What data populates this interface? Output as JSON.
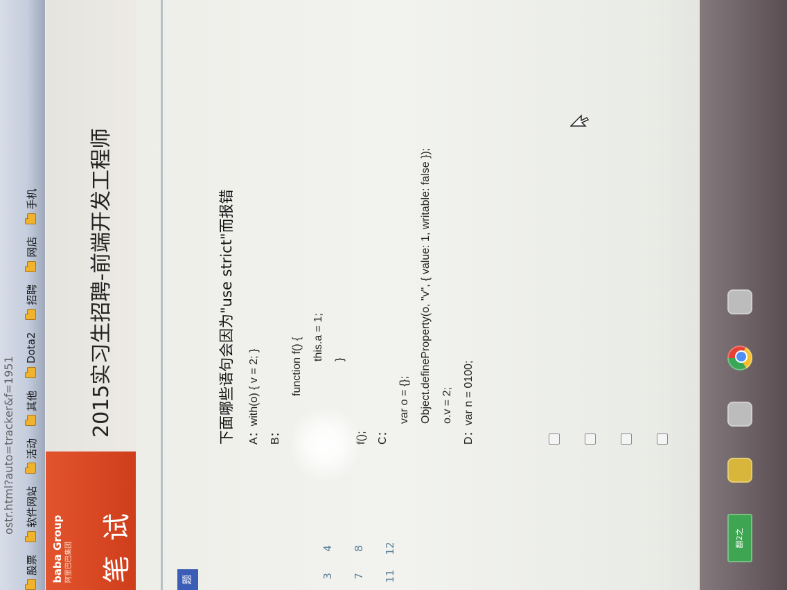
{
  "browser": {
    "url_fragment": "ostr.html?auto=tracker&f=1951",
    "bookmarks": [
      {
        "label": "股票",
        "icon": "folder-icon"
      },
      {
        "label": "软件网站",
        "icon": "folder-icon"
      },
      {
        "label": "活动",
        "icon": "folder-icon"
      },
      {
        "label": "其他",
        "icon": "folder-icon"
      },
      {
        "label": "Dota2",
        "icon": "folder-icon"
      },
      {
        "label": "招聘",
        "icon": "folder-icon"
      },
      {
        "label": "网店",
        "icon": "folder-icon"
      },
      {
        "label": "手机",
        "icon": "folder-icon"
      }
    ]
  },
  "header": {
    "brand": "baba Group",
    "brand_sub": "阿里巴巴集团",
    "section_title": "笔 试",
    "job_title": "2015实习生招聘-前端开发工程师"
  },
  "sidebar": {
    "tab_label": "题",
    "question_numbers": [
      [
        "3",
        "4"
      ],
      [
        "7",
        "8"
      ],
      [
        "11",
        "12"
      ]
    ]
  },
  "question": {
    "stem": "下面哪些语句会因为\"use strict\"而报错",
    "lines": [
      {
        "text": "A：with(o) { v = 2; }",
        "indent": 0
      },
      {
        "text": "B：",
        "indent": 0
      },
      {
        "text": "function f() {",
        "indent": 1
      },
      {
        "text": "this.a = 1;",
        "indent": 2
      },
      {
        "text": "}",
        "indent": 2
      },
      {
        "text": "f();",
        "indent": 0
      },
      {
        "text": "C：",
        "indent": 0
      },
      {
        "text": "var o = {};",
        "indent": 3
      },
      {
        "text": "Object.defineProperty(o, \"v\", { value: 1, writable: false });",
        "indent": 3
      },
      {
        "text": "o.v = 2;",
        "indent": 3
      },
      {
        "text": "D：var n = 0100;",
        "indent": 0
      }
    ],
    "options": [
      "A",
      "B",
      "C",
      "D"
    ]
  },
  "taskbar": {
    "green_badge": "翻2之"
  }
}
